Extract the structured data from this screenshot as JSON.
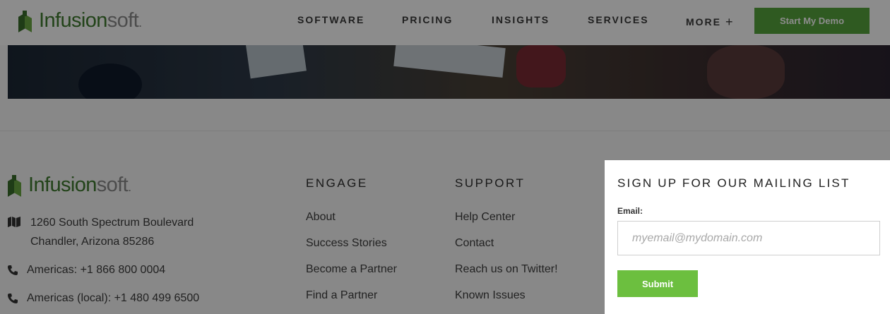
{
  "header": {
    "logo": {
      "part1": "Infusion",
      "part2": "soft",
      "dot": "."
    },
    "nav": [
      "SOFTWARE",
      "PRICING",
      "INSIGHTS",
      "SERVICES",
      "MORE"
    ],
    "more_plus": "+",
    "demo_button": "Start My Demo"
  },
  "footer": {
    "logo": {
      "part1": "Infusion",
      "part2": "soft",
      "dot": "."
    },
    "address": {
      "line1": "1260 South Spectrum Boulevard",
      "line2": "Chandler, Arizona 85286"
    },
    "phones": [
      "Americas: +1 866 800 0004",
      "Americas (local): +1 480 499 6500"
    ],
    "engage": {
      "heading": "ENGAGE",
      "links": [
        "About",
        "Success Stories",
        "Become a Partner",
        "Find a Partner"
      ]
    },
    "support": {
      "heading": "SUPPORT",
      "links": [
        "Help Center",
        "Contact",
        "Reach us on Twitter!",
        "Known Issues"
      ]
    }
  },
  "modal": {
    "title": "SIGN UP FOR OUR MAILING LIST",
    "email_label": "Email:",
    "email_placeholder": "myemail@mydomain.com",
    "submit": "Submit"
  },
  "colors": {
    "brand_green": "#3f7a2e",
    "button_green": "#56a43c",
    "submit_green": "#6cbf3f",
    "overlay": "rgba(0,0,0,0.45)"
  },
  "icons": [
    "map-icon",
    "phone-icon",
    "plus-icon",
    "logo-mark-icon"
  ]
}
